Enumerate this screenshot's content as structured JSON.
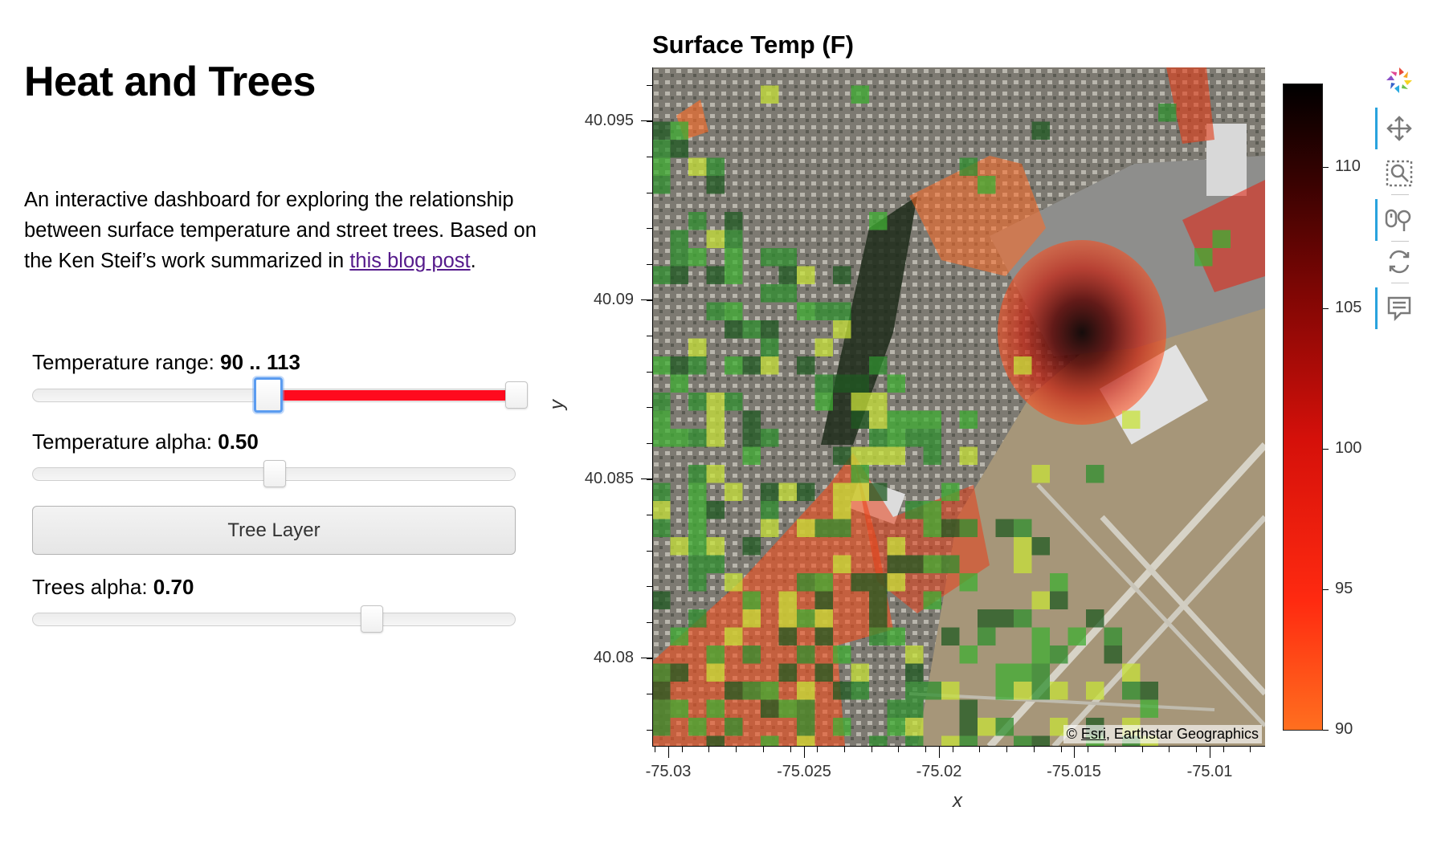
{
  "page": {
    "title": "Heat and Trees",
    "description_before_link": "An interactive dashboard for exploring the relationship between surface temperature and street trees. Based on the Ken Steif’s work summarized in ",
    "description_link": "this blog post",
    "description_after_link": "."
  },
  "controls": {
    "temp_range": {
      "label": "Temperature range: ",
      "value_text": "90 .. 113",
      "min": 90,
      "max": 113,
      "low": 90,
      "high": 113
    },
    "temp_alpha": {
      "label": "Temperature alpha: ",
      "value_text": "0.50",
      "fraction": 0.5
    },
    "tree_button": {
      "label": "Tree Layer"
    },
    "trees_alpha": {
      "label": "Trees alpha: ",
      "value_text": "0.70",
      "fraction": 0.7
    }
  },
  "plot": {
    "title": "Surface Temp (F)",
    "xlabel": "x",
    "ylabel": "y",
    "x_ticks": [
      "-75.03",
      "-75.025",
      "-75.02",
      "-75.015",
      "-75.01"
    ],
    "y_ticks": [
      "40.095",
      "40.09",
      "40.085",
      "40.08"
    ],
    "attribution_prefix": "© ",
    "attribution_link": "Esri",
    "attribution_suffix": ", Earthstar Geographics",
    "colorbar_ticks": [
      "110",
      "105",
      "100",
      "95",
      "90"
    ],
    "colorbar_range": [
      90,
      113
    ],
    "colormap": [
      "#ff6f1f",
      "#ff2a10",
      "#d5100a",
      "#7e0604",
      "#380201",
      "#000000"
    ]
  },
  "toolbar": {
    "tools": [
      "logo-icon",
      "pan-icon",
      "box-zoom-icon",
      "wheel-zoom-icon",
      "reset-icon",
      "hover-icon"
    ],
    "accent": "#29a3dd"
  },
  "tree_colors": [
    "#2f8f2f",
    "#3fae33",
    "#c7e23a",
    "#1f5a22"
  ]
}
